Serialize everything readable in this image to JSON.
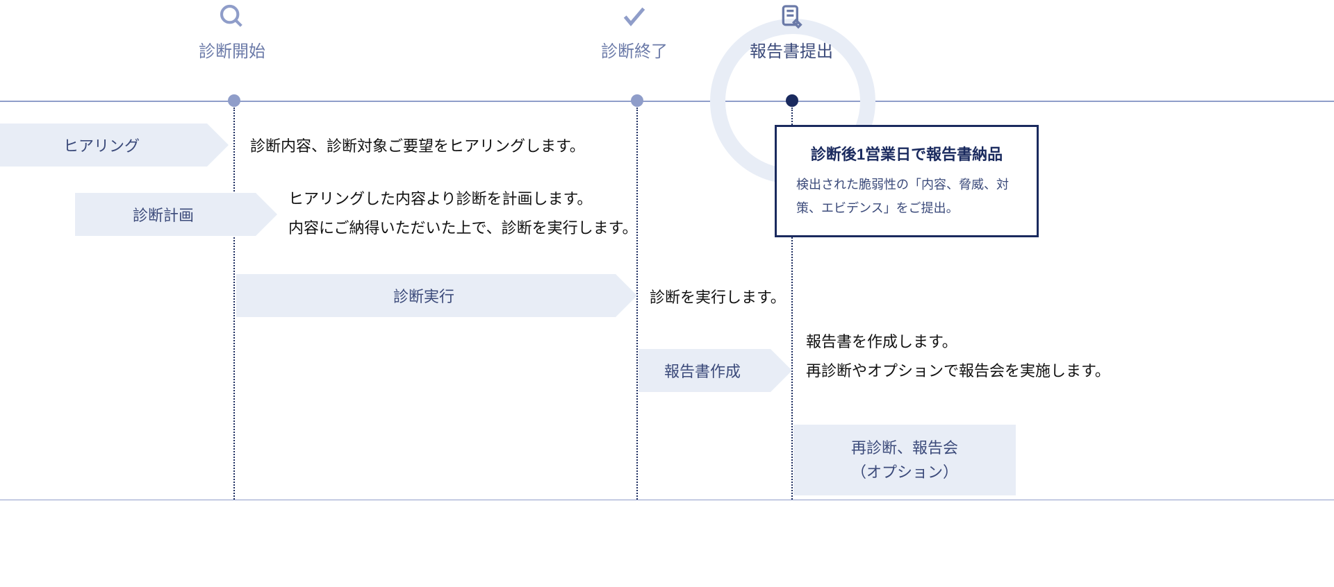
{
  "colors": {
    "accent": "#8f9dc9",
    "dark": "#1a2a5e",
    "fill": "#e8edf6",
    "text": "#3b4a7a"
  },
  "milestones": [
    {
      "id": "start",
      "label": "診断開始",
      "icon": "search-icon",
      "highlight": false
    },
    {
      "id": "end",
      "label": "診断終了",
      "icon": "check-icon",
      "highlight": false
    },
    {
      "id": "report",
      "label": "報告書提出",
      "icon": "document-icon",
      "highlight": true
    }
  ],
  "steps": [
    {
      "id": "hearing",
      "label": "ヒアリング",
      "desc": "診断内容、診断対象ご要望をヒアリングします。"
    },
    {
      "id": "plan",
      "label": "診断計画",
      "desc": "ヒアリングした内容より診断を計画します。\n内容にご納得いただいた上で、診断を実行します。"
    },
    {
      "id": "exec",
      "label": "診断実行",
      "desc": "診断を実行します。"
    },
    {
      "id": "write",
      "label": "報告書作成",
      "desc": "報告書を作成します。\n再診断やオプションで報告会を実施します。"
    }
  ],
  "callout": {
    "title": "診断後1営業日で報告書納品",
    "body": "検出された脆弱性の「内容、脅威、対策、エビデンス」をご提出。"
  },
  "option": {
    "line1": "再診断、報告会",
    "line2": "（オプション）"
  }
}
